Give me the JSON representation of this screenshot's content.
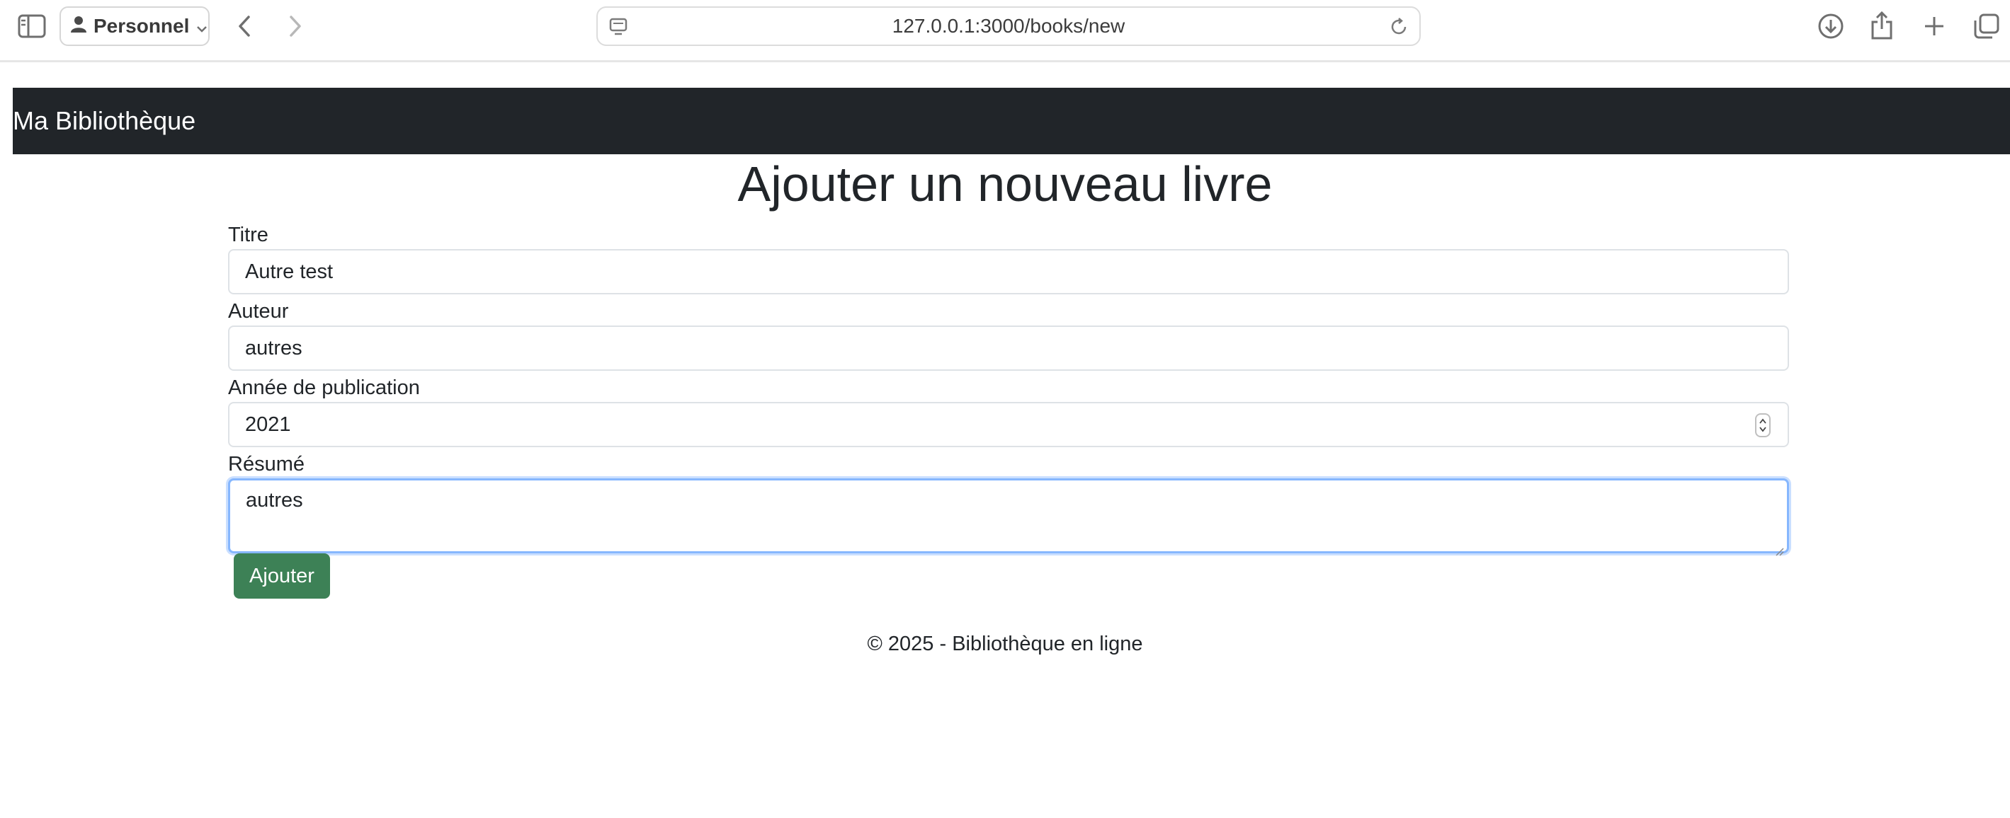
{
  "browser": {
    "profile_label": "Personnel",
    "url": "127.0.0.1:3000/books/new",
    "icons": {
      "sidebar": "sidebar-icon",
      "profile": "person-icon",
      "back": "chevron-left-icon",
      "forward": "chevron-right-icon",
      "page": "page-menu-icon",
      "reload": "reload-icon",
      "download": "download-icon",
      "share": "share-icon",
      "new_tab": "plus-icon",
      "tabs": "tabs-overview-icon"
    }
  },
  "navbar": {
    "brand": "Ma Bibliothèque",
    "background": "#212529"
  },
  "page": {
    "title": "Ajouter un nouveau livre"
  },
  "form": {
    "title_label": "Titre",
    "title_value": "Autre test",
    "author_label": "Auteur",
    "author_value": "autres",
    "year_label": "Année de publication",
    "year_value": "2021",
    "summary_label": "Résumé",
    "summary_value": "autres",
    "submit_label": "Ajouter",
    "submit_color": "#3d8156"
  },
  "footer": {
    "text": "© 2025 - Bibliothèque en ligne"
  }
}
